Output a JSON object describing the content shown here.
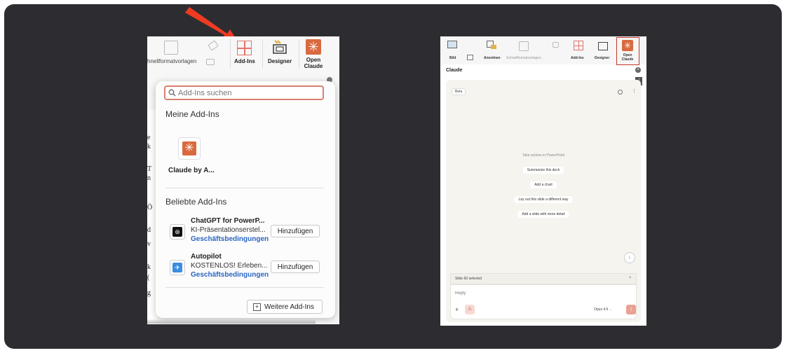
{
  "left": {
    "ribbon": {
      "schnellformat_label": "hnellformatvorlagen",
      "addins_label": "Add-Ins",
      "designer_label": "Designer",
      "open_claude_label": "Open\nClaude"
    },
    "dropdown": {
      "search_placeholder": "Add-Ins suchen",
      "my_addins_heading": "Meine Add-Ins",
      "my_addins": [
        {
          "name": "Claude by A..."
        }
      ],
      "popular_heading": "Beliebte Add-Ins",
      "popular": [
        {
          "name": "ChatGPT for PowerP...",
          "desc": "KI-Präsentationserstel...",
          "link": "Geschäftsbedingungen",
          "button": "Hinzufügen"
        },
        {
          "name": "Autopilot",
          "desc": "KOSTENLOS! Erleben...",
          "link": "Geschäftsbedingungen",
          "button": "Hinzufügen"
        }
      ],
      "more_button": "Weitere Add-Ins"
    },
    "slide_fragments": [
      "e",
      "k",
      "T",
      "n",
      "Ö",
      "d",
      "v",
      "k",
      "(",
      "g"
    ]
  },
  "right": {
    "ribbon": {
      "bild_label": "Bild",
      "anordnen_label": "Anordnen",
      "schnellformat_label": "Schnellformatvorlagen",
      "addins_label": "Add-Ins",
      "designer_label": "Designer",
      "open_claude_label": "Open\nClaude"
    },
    "pane": {
      "title": "Claude",
      "beta_badge": "Beta",
      "intro": "Take actions in PowerPoint",
      "suggestions": [
        "Summarize this deck",
        "Add a chart",
        "Lay out this slide a different way",
        "Add a slide with more detail"
      ],
      "status": "Slide 60 selected",
      "reply_placeholder": "Reply",
      "model": "Opus 4.6"
    }
  },
  "colors": {
    "accent": "#d9693f",
    "arrow": "#ee3b22",
    "link": "#2b66c3"
  }
}
